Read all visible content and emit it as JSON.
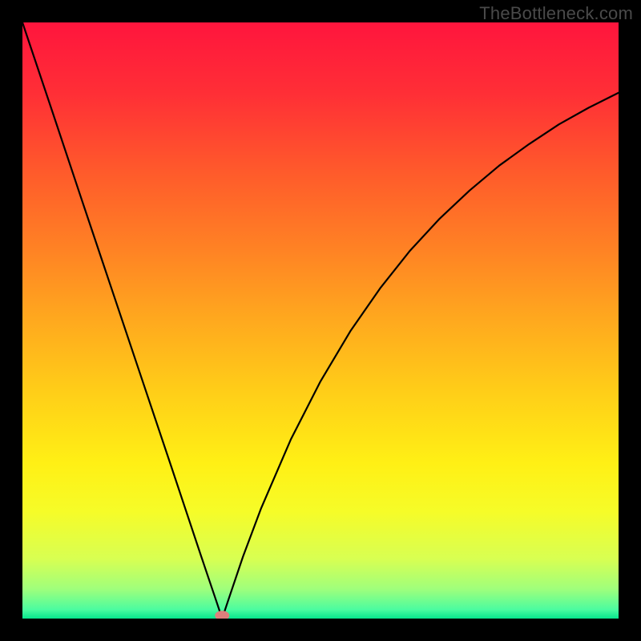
{
  "watermark": "TheBottleneck.com",
  "chart_data": {
    "type": "line",
    "title": "",
    "xlabel": "",
    "ylabel": "",
    "xlim": [
      0,
      100
    ],
    "ylim": [
      0,
      100
    ],
    "grid": false,
    "annotations": [],
    "series": [
      {
        "name": "curve",
        "x": [
          0,
          5,
          10,
          15,
          20,
          25,
          30,
          32.5,
          33.5,
          34.5,
          37,
          40,
          45,
          50,
          55,
          60,
          65,
          70,
          75,
          80,
          85,
          90,
          95,
          100
        ],
        "y": [
          100,
          85.1,
          70.1,
          55.2,
          40.3,
          25.4,
          10.4,
          3.0,
          0.0,
          3.0,
          10.4,
          18.4,
          30.0,
          39.8,
          48.2,
          55.4,
          61.7,
          67.1,
          71.8,
          76.0,
          79.6,
          82.9,
          85.7,
          88.2
        ]
      }
    ],
    "marker": {
      "x": 33.5,
      "y": 0.5
    },
    "background_gradient": {
      "stops": [
        {
          "offset": 0.0,
          "color": "#ff153d"
        },
        {
          "offset": 0.12,
          "color": "#ff2f36"
        },
        {
          "offset": 0.25,
          "color": "#ff5a2b"
        },
        {
          "offset": 0.38,
          "color": "#ff8224"
        },
        {
          "offset": 0.5,
          "color": "#ffa91e"
        },
        {
          "offset": 0.62,
          "color": "#ffce18"
        },
        {
          "offset": 0.74,
          "color": "#fff015"
        },
        {
          "offset": 0.82,
          "color": "#f6fc28"
        },
        {
          "offset": 0.9,
          "color": "#d8ff52"
        },
        {
          "offset": 0.95,
          "color": "#a0ff7b"
        },
        {
          "offset": 0.985,
          "color": "#4bfca0"
        },
        {
          "offset": 1.0,
          "color": "#06e58d"
        }
      ]
    }
  }
}
